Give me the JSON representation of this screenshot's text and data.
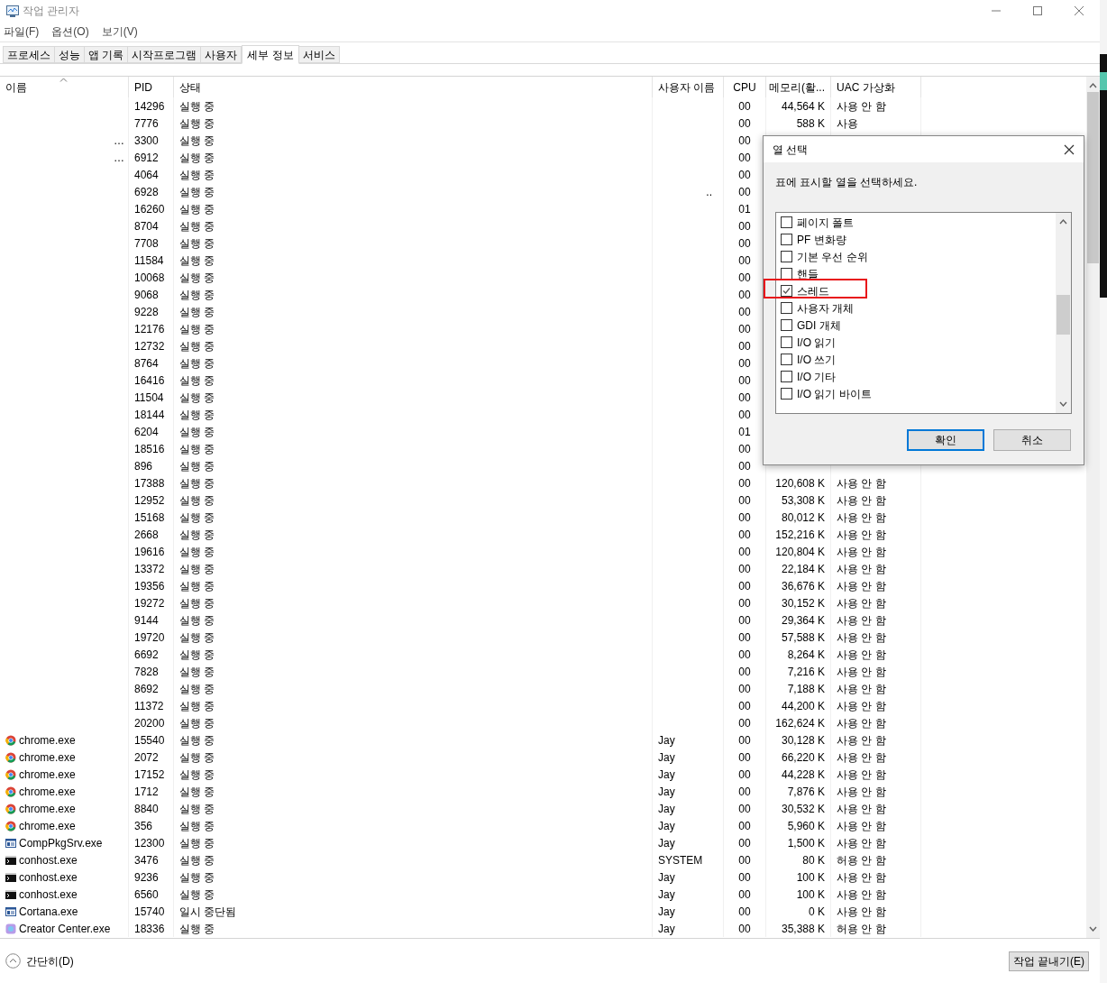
{
  "window": {
    "title": "작업 관리자"
  },
  "menu": [
    "파일(F)",
    "옵션(O)",
    "보기(V)"
  ],
  "tabs": [
    {
      "label": "프로세스",
      "selected": false
    },
    {
      "label": "성능",
      "selected": false
    },
    {
      "label": "앱 기록",
      "selected": false
    },
    {
      "label": "시작프로그램",
      "selected": false
    },
    {
      "label": "사용자",
      "selected": false
    },
    {
      "label": "세부 정보",
      "selected": true
    },
    {
      "label": "서비스",
      "selected": false
    }
  ],
  "table": {
    "columns": [
      "이름",
      "PID",
      "상태",
      "사용자 이름",
      "CPU",
      "메모리(활...",
      "UAC 가상화"
    ],
    "rows": [
      {
        "pid": "14296",
        "status": "실행 중",
        "cpu": "00",
        "memory": "44,564 K",
        "uac": "사용 안 함"
      },
      {
        "pid": "7776",
        "status": "실행 중",
        "cpu": "00",
        "memory": "588 K",
        "uac": "사용"
      },
      {
        "name": "…",
        "pid": "3300",
        "status": "실행 중",
        "cpu": "00"
      },
      {
        "name": "…",
        "pid": "6912",
        "status": "실행 중",
        "cpu": "00"
      },
      {
        "pid": "4064",
        "status": "실행 중",
        "cpu": "00"
      },
      {
        "pid": "6928",
        "status": "실행 중",
        "user": "..",
        "cpu": "00"
      },
      {
        "pid": "16260",
        "status": "실행 중",
        "cpu": "01"
      },
      {
        "pid": "8704",
        "status": "실행 중",
        "cpu": "00"
      },
      {
        "pid": "7708",
        "status": "실행 중",
        "cpu": "00"
      },
      {
        "pid": "11584",
        "status": "실행 중",
        "cpu": "00"
      },
      {
        "pid": "10068",
        "status": "실행 중",
        "cpu": "00"
      },
      {
        "pid": "9068",
        "status": "실행 중",
        "cpu": "00"
      },
      {
        "pid": "9228",
        "status": "실행 중",
        "cpu": "00"
      },
      {
        "pid": "12176",
        "status": "실행 중",
        "cpu": "00"
      },
      {
        "pid": "12732",
        "status": "실행 중",
        "cpu": "00"
      },
      {
        "pid": "8764",
        "status": "실행 중",
        "cpu": "00"
      },
      {
        "pid": "16416",
        "status": "실행 중",
        "cpu": "00"
      },
      {
        "pid": "11504",
        "status": "실행 중",
        "cpu": "00"
      },
      {
        "pid": "18144",
        "status": "실행 중",
        "cpu": "00"
      },
      {
        "pid": "6204",
        "status": "실행 중",
        "cpu": "01"
      },
      {
        "pid": "18516",
        "status": "실행 중",
        "cpu": "00"
      },
      {
        "pid": "896",
        "status": "실행 중",
        "cpu": "00"
      },
      {
        "pid": "17388",
        "status": "실행 중",
        "cpu": "00",
        "memory": "120,608 K",
        "uac": "사용 안 함"
      },
      {
        "pid": "12952",
        "status": "실행 중",
        "cpu": "00",
        "memory": "53,308 K",
        "uac": "사용 안 함"
      },
      {
        "pid": "15168",
        "status": "실행 중",
        "cpu": "00",
        "memory": "80,012 K",
        "uac": "사용 안 함"
      },
      {
        "pid": "2668",
        "status": "실행 중",
        "cpu": "00",
        "memory": "152,216 K",
        "uac": "사용 안 함"
      },
      {
        "pid": "19616",
        "status": "실행 중",
        "cpu": "00",
        "memory": "120,804 K",
        "uac": "사용 안 함"
      },
      {
        "pid": "13372",
        "status": "실행 중",
        "cpu": "00",
        "memory": "22,184 K",
        "uac": "사용 안 함"
      },
      {
        "pid": "19356",
        "status": "실행 중",
        "cpu": "00",
        "memory": "36,676 K",
        "uac": "사용 안 함"
      },
      {
        "pid": "19272",
        "status": "실행 중",
        "cpu": "00",
        "memory": "30,152 K",
        "uac": "사용 안 함"
      },
      {
        "pid": "9144",
        "status": "실행 중",
        "cpu": "00",
        "memory": "29,364 K",
        "uac": "사용 안 함"
      },
      {
        "pid": "19720",
        "status": "실행 중",
        "cpu": "00",
        "memory": "57,588 K",
        "uac": "사용 안 함"
      },
      {
        "pid": "6692",
        "status": "실행 중",
        "cpu": "00",
        "memory": "8,264 K",
        "uac": "사용 안 함"
      },
      {
        "pid": "7828",
        "status": "실행 중",
        "cpu": "00",
        "memory": "7,216 K",
        "uac": "사용 안 함"
      },
      {
        "pid": "8692",
        "status": "실행 중",
        "cpu": "00",
        "memory": "7,188 K",
        "uac": "사용 안 함"
      },
      {
        "pid": "11372",
        "status": "실행 중",
        "cpu": "00",
        "memory": "44,200 K",
        "uac": "사용 안 함"
      },
      {
        "pid": "20200",
        "status": "실행 중",
        "cpu": "00",
        "memory": "162,624 K",
        "uac": "사용 안 함"
      },
      {
        "kind": "chrome",
        "name": "chrome.exe",
        "pid": "15540",
        "status": "실행 중",
        "user": "Jay",
        "cpu": "00",
        "memory": "30,128 K",
        "uac": "사용 안 함"
      },
      {
        "kind": "chrome",
        "name": "chrome.exe",
        "pid": "2072",
        "status": "실행 중",
        "user": "Jay",
        "cpu": "00",
        "memory": "66,220 K",
        "uac": "사용 안 함"
      },
      {
        "kind": "chrome",
        "name": "chrome.exe",
        "pid": "17152",
        "status": "실행 중",
        "user": "Jay",
        "cpu": "00",
        "memory": "44,228 K",
        "uac": "사용 안 함"
      },
      {
        "kind": "chrome",
        "name": "chrome.exe",
        "pid": "1712",
        "status": "실행 중",
        "user": "Jay",
        "cpu": "00",
        "memory": "7,876 K",
        "uac": "사용 안 함"
      },
      {
        "kind": "chrome",
        "name": "chrome.exe",
        "pid": "8840",
        "status": "실행 중",
        "user": "Jay",
        "cpu": "00",
        "memory": "30,532 K",
        "uac": "사용 안 함"
      },
      {
        "kind": "chrome",
        "name": "chrome.exe",
        "pid": "356",
        "status": "실행 중",
        "user": "Jay",
        "cpu": "00",
        "memory": "5,960 K",
        "uac": "사용 안 함"
      },
      {
        "kind": "app",
        "name": "CompPkgSrv.exe",
        "pid": "12300",
        "status": "실행 중",
        "user": "Jay",
        "cpu": "00",
        "memory": "1,500 K",
        "uac": "사용 안 함"
      },
      {
        "kind": "console",
        "name": "conhost.exe",
        "pid": "3476",
        "status": "실행 중",
        "user": "SYSTEM",
        "cpu": "00",
        "memory": "80 K",
        "uac": "허용 안 함"
      },
      {
        "kind": "console",
        "name": "conhost.exe",
        "pid": "9236",
        "status": "실행 중",
        "user": "Jay",
        "cpu": "00",
        "memory": "100 K",
        "uac": "사용 안 함"
      },
      {
        "kind": "console",
        "name": "conhost.exe",
        "pid": "6560",
        "status": "실행 중",
        "user": "Jay",
        "cpu": "00",
        "memory": "100 K",
        "uac": "사용 안 함"
      },
      {
        "kind": "app",
        "name": "Cortana.exe",
        "pid": "15740",
        "status": "일시 중단됨",
        "user": "Jay",
        "cpu": "00",
        "memory": "0 K",
        "uac": "사용 안 함"
      },
      {
        "kind": "creator",
        "name": "Creator Center.exe",
        "pid": "18336",
        "status": "실행 중",
        "user": "Jay",
        "cpu": "00",
        "memory": "35,388 K",
        "uac": "허용 안 함"
      }
    ]
  },
  "footer": {
    "collapse": "간단히(D)",
    "end_task": "작업 끝내기(E)"
  },
  "dialog": {
    "title": "열 선택",
    "prompt": "표에 표시할 열을 선택하세요.",
    "options": [
      {
        "label": "페이지 폴트",
        "checked": false,
        "highlighted": false
      },
      {
        "label": "PF 변화량",
        "checked": false,
        "highlighted": false
      },
      {
        "label": "기본 우선 순위",
        "checked": false,
        "highlighted": false
      },
      {
        "label": "핸들",
        "checked": false,
        "highlighted": false
      },
      {
        "label": "스레드",
        "checked": true,
        "highlighted": true
      },
      {
        "label": "사용자 개체",
        "checked": false,
        "highlighted": false
      },
      {
        "label": "GDI 개체",
        "checked": false,
        "highlighted": false
      },
      {
        "label": "I/O 읽기",
        "checked": false,
        "highlighted": false
      },
      {
        "label": "I/O 쓰기",
        "checked": false,
        "highlighted": false
      },
      {
        "label": "I/O 기타",
        "checked": false,
        "highlighted": false
      },
      {
        "label": "I/O 읽기 바이트",
        "checked": false,
        "highlighted": false
      }
    ],
    "buttons": [
      {
        "label": "확인",
        "default": true
      },
      {
        "label": "취소",
        "default": false
      }
    ]
  }
}
